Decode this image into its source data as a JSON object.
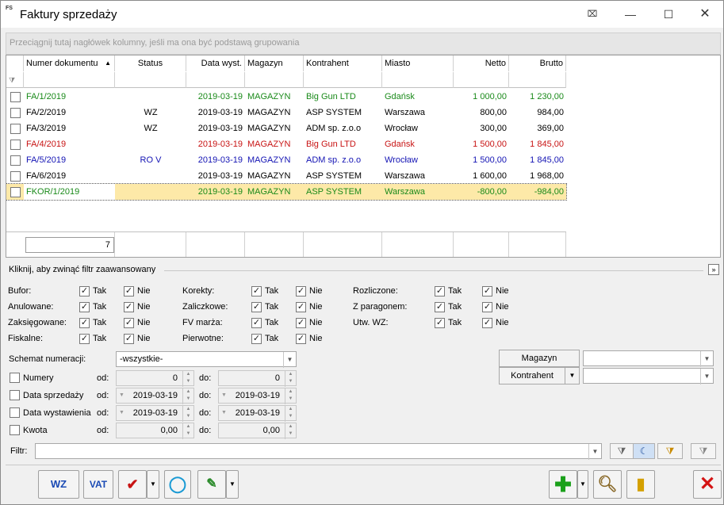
{
  "window": {
    "title": "Faktury sprzedaży",
    "icon_text": "FS"
  },
  "group_hint": "Przeciągnij tutaj nagłówek kolumny, jeśli ma ona być podstawą grupowania",
  "columns": [
    "Numer dokumentu",
    "Status",
    "Data wyst.",
    "Magazyn",
    "Kontrahent",
    "Miasto",
    "Netto",
    "Brutto"
  ],
  "rows": [
    {
      "nr": "FA/1/2019",
      "status": "",
      "data": "2019-03-19",
      "mag": "MAGAZYN",
      "kontr": "Big Gun LTD",
      "miasto": "Gdańsk",
      "netto": "1 000,00",
      "brutto": "1 230,00",
      "color": "#1a8a1a"
    },
    {
      "nr": "FA/2/2019",
      "status": "WZ",
      "data": "2019-03-19",
      "mag": "MAGAZYN",
      "kontr": "ASP SYSTEM",
      "miasto": "Warszawa",
      "netto": "800,00",
      "brutto": "984,00",
      "color": "#000000"
    },
    {
      "nr": "FA/3/2019",
      "status": "WZ",
      "data": "2019-03-19",
      "mag": "MAGAZYN",
      "kontr": "ADM sp. z.o.o",
      "miasto": "Wrocław",
      "netto": "300,00",
      "brutto": "369,00",
      "color": "#000000"
    },
    {
      "nr": "FA/4/2019",
      "status": "",
      "data": "2019-03-19",
      "mag": "MAGAZYN",
      "kontr": "Big Gun LTD",
      "miasto": "Gdańsk",
      "netto": "1 500,00",
      "brutto": "1 845,00",
      "color": "#c81414"
    },
    {
      "nr": "FA/5/2019",
      "status": "RO V",
      "data": "2019-03-19",
      "mag": "MAGAZYN",
      "kontr": "ADM sp. z.o.o",
      "miasto": "Wrocław",
      "netto": "1 500,00",
      "brutto": "1 845,00",
      "color": "#1414b4"
    },
    {
      "nr": "FA/6/2019",
      "status": "",
      "data": "2019-03-19",
      "mag": "MAGAZYN",
      "kontr": "ASP SYSTEM",
      "miasto": "Warszawa",
      "netto": "1 600,00",
      "brutto": "1 968,00",
      "color": "#000000"
    },
    {
      "nr": "FKOR/1/2019",
      "status": "",
      "data": "2019-03-19",
      "mag": "MAGAZYN",
      "kontr": "ASP SYSTEM",
      "miasto": "Warszawa",
      "netto": "-800,00",
      "brutto": "-984,00",
      "color": "#1a8a1a",
      "selected": true
    }
  ],
  "footer_count": "7",
  "advanced": {
    "title": "Kliknij, aby zwinąć filtr zaawansowany",
    "tak": "Tak",
    "nie": "Nie",
    "col1": [
      "Bufor:",
      "Anulowane:",
      "Zaksięgowane:",
      "Fiskalne:"
    ],
    "col2": [
      "Korekty:",
      "Zaliczkowe:",
      "FV marża:",
      "Pierwotne:"
    ],
    "col3": [
      "Rozliczone:",
      "Z paragonem:",
      "Utw. WZ:"
    ],
    "schemat_label": "Schemat numeracji:",
    "schemat_value": "-wszystkie-",
    "ranges": [
      {
        "label": "Numery",
        "od": "0",
        "do": "0"
      },
      {
        "label": "Data sprzedaży",
        "od": "2019-03-19",
        "do": "2019-03-19"
      },
      {
        "label": "Data wystawienia",
        "od": "2019-03-19",
        "do": "2019-03-19"
      },
      {
        "label": "Kwota",
        "od": "0,00",
        "do": "0,00"
      }
    ],
    "od_label": "od:",
    "do_label": "do:",
    "magazyn_btn": "Magazyn",
    "kontrahent_btn": "Kontrahent",
    "filtr_label": "Filtr:"
  },
  "toolbar": {
    "wz": "WZ",
    "vat": "VAT"
  }
}
